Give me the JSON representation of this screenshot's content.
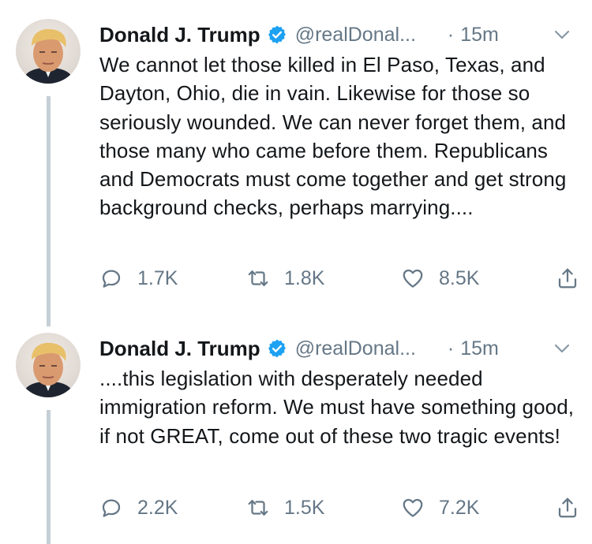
{
  "tweets": [
    {
      "author_name": "Donald J. Trump",
      "handle": "@realDonal...",
      "separator": "·",
      "time": "15m",
      "verified": true,
      "text": "We cannot let those killed in El Paso, Texas, and Dayton, Ohio, die in vain. Likewise for those so seriously wounded. We can never forget them, and those many who came before them. Republicans and Democrats must come together and get strong background checks, perhaps marrying....",
      "replies": "1.7K",
      "retweets": "1.8K",
      "likes": "8.5K"
    },
    {
      "author_name": "Donald J. Trump",
      "handle": "@realDonal...",
      "separator": "·",
      "time": "15m",
      "verified": true,
      "text": "....this legislation with desperately needed immigration reform. We must have something good, if not GREAT, come out of these two tragic events!",
      "replies": "2.2K",
      "retweets": "1.5K",
      "likes": "7.2K"
    }
  ],
  "icons": {
    "reply": "reply-icon",
    "retweet": "retweet-icon",
    "like": "heart-icon",
    "share": "share-icon",
    "verified": "verified-badge-icon",
    "more": "chevron-down-icon"
  },
  "colors": {
    "verified_blue": "#1da1f2",
    "secondary_text": "#657786",
    "thread_line": "#c4cfd6"
  }
}
